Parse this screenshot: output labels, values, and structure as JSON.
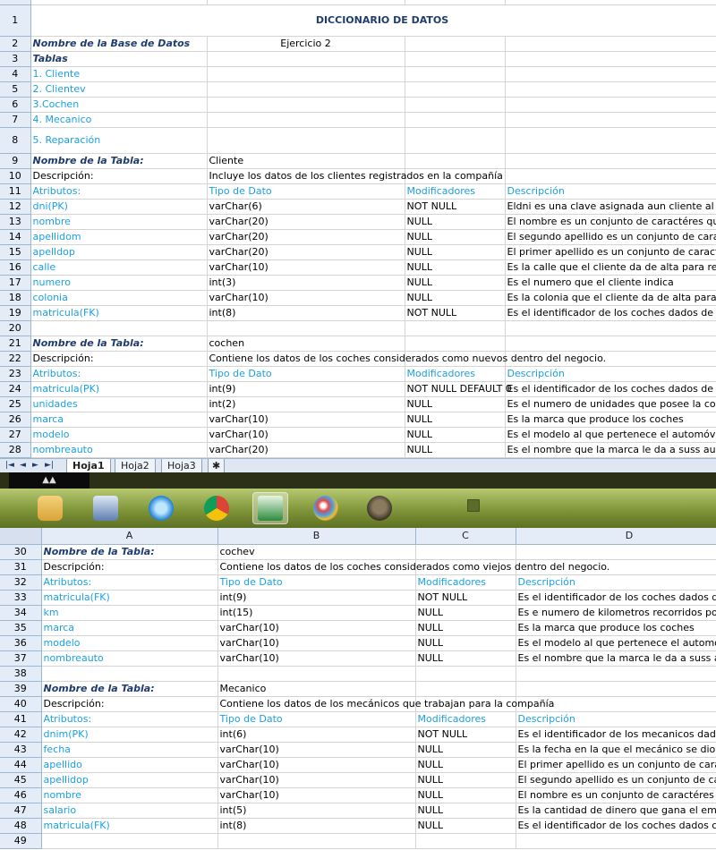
{
  "columns": [
    "A",
    "B",
    "C",
    "D"
  ],
  "sheet1": {
    "title": "DICCIONARIO DE DATOS",
    "rows": [
      {
        "n": "2",
        "a": "Nombre de la Base de Datos",
        "b": "Ejercicio 2",
        "c": "",
        "d": ""
      },
      {
        "n": "3",
        "a": "Tablas",
        "b": "",
        "c": "",
        "d": ""
      },
      {
        "n": "4",
        "a": "1. Cliente",
        "b": "",
        "c": "",
        "d": ""
      },
      {
        "n": "5",
        "a": "2. Clientev",
        "b": "",
        "c": "",
        "d": ""
      },
      {
        "n": "6",
        "a": "3.Cochen",
        "b": "",
        "c": "",
        "d": ""
      },
      {
        "n": "7",
        "a": "4. Mecanico",
        "b": "",
        "c": "",
        "d": ""
      },
      {
        "n": "8",
        "a": "5. Reparación",
        "b": "",
        "c": "",
        "d": ""
      },
      {
        "n": "9",
        "a": "Nombre de la Tabla:",
        "b": "Cliente",
        "c": "",
        "d": ""
      },
      {
        "n": "10",
        "a": "Descripción:",
        "b": "Incluye los datos de los clientes registrados en la compañía",
        "c": "",
        "d": ""
      },
      {
        "n": "11",
        "a": "Atributos:",
        "b": "Tipo de Dato",
        "c": "Modificadores",
        "d": "Descripción"
      },
      {
        "n": "12",
        "a": "dni(PK)",
        "b": "varChar(6)",
        "c": "NOT NULL",
        "d": "Eldni es una clave asignada aun cliente al"
      },
      {
        "n": "13",
        "a": "nombre",
        "b": "varChar(20)",
        "c": "NULL",
        "d": "El nombre es un conjunto de caractéres que"
      },
      {
        "n": "14",
        "a": "apellidom",
        "b": "varChar(20)",
        "c": "NULL",
        "d": "El segundo apellido es un conjunto de cara"
      },
      {
        "n": "15",
        "a": "apelldop",
        "b": "varChar(20)",
        "c": "NULL",
        "d": "El primer apellido es un conjunto de caract"
      },
      {
        "n": "16",
        "a": "calle",
        "b": "varChar(10)",
        "c": "NULL",
        "d": "Es la calle que el cliente da de alta para re"
      },
      {
        "n": "17",
        "a": "numero",
        "b": "int(3)",
        "c": "NULL",
        "d": "Es el numero que el cliente indica"
      },
      {
        "n": "18",
        "a": "colonia",
        "b": "varChar(10)",
        "c": "NULL",
        "d": "Es la colonia que el cliente da de alta para"
      },
      {
        "n": "19",
        "a": "matricula(FK)",
        "b": "int(8)",
        "c": "NOT NULL",
        "d": "Es el identificador de los coches dados de"
      },
      {
        "n": "20",
        "a": "",
        "b": "",
        "c": "",
        "d": ""
      },
      {
        "n": "21",
        "a": "Nombre de la Tabla:",
        "b": "cochen",
        "c": "",
        "d": ""
      },
      {
        "n": "22",
        "a": "Descripción:",
        "b": "Contiene los datos de los coches considerados como  nuevos dentro del negocio.",
        "c": "",
        "d": ""
      },
      {
        "n": "23",
        "a": "Atributos:",
        "b": "Tipo de Dato",
        "c": "Modificadores",
        "d": "Descripción"
      },
      {
        "n": "24",
        "a": "matricula(PK)",
        "b": "int(9)",
        "c": "NOT NULL DEFAULT 0",
        "d": "Es el identificador de los coches dados de"
      },
      {
        "n": "25",
        "a": "unidades",
        "b": "int(2)",
        "c": "NULL",
        "d": "Es el numero de unidades que posee la co"
      },
      {
        "n": "26",
        "a": "marca",
        "b": "varChar(10)",
        "c": "NULL",
        "d": "Es la marca que produce los coches"
      },
      {
        "n": "27",
        "a": "modelo",
        "b": "varChar(10)",
        "c": "NULL",
        "d": "Es el modelo al que pertenece el automóvi"
      },
      {
        "n": "28",
        "a": "nombreauto",
        "b": "varChar(20)",
        "c": "NULL",
        "d": "Es el nombre que la marca le da a suss au"
      }
    ],
    "tabs": [
      "Hoja1",
      "Hoja2",
      "Hoja3"
    ]
  },
  "sheet2": {
    "rows": [
      {
        "n": "30",
        "a": "Nombre de la Tabla:",
        "b": "cochev",
        "c": "",
        "d": ""
      },
      {
        "n": "31",
        "a": "Descripción:",
        "b": "Contiene los datos de los coches considerados como  viejos dentro del negocio.",
        "c": "",
        "d": ""
      },
      {
        "n": "32",
        "a": "Atributos:",
        "b": "Tipo de Dato",
        "c": "Modificadores",
        "d": "Descripción"
      },
      {
        "n": "33",
        "a": "matricula(FK)",
        "b": "int(9)",
        "c": "NOT NULL",
        "d": "Es el identificador de los coches dados d"
      },
      {
        "n": "34",
        "a": "km",
        "b": "int(15)",
        "c": "NULL",
        "d": "Es e numero de kilometros recorridos po"
      },
      {
        "n": "35",
        "a": "marca",
        "b": "varChar(10)",
        "c": "NULL",
        "d": "Es la marca que produce los coches"
      },
      {
        "n": "36",
        "a": "modelo",
        "b": "varChar(10)",
        "c": "NULL",
        "d": "Es el modelo al que pertenece el automo"
      },
      {
        "n": "37",
        "a": "nombreauto",
        "b": "varChar(10)",
        "c": "NULL",
        "d": "Es el nombre que la marca le da a suss a"
      },
      {
        "n": "38",
        "a": "",
        "b": "",
        "c": "",
        "d": ""
      },
      {
        "n": "39",
        "a": "Nombre de la Tabla:",
        "b": "Mecanico",
        "c": "",
        "d": ""
      },
      {
        "n": "40",
        "a": "Descripción:",
        "b": "Contiene los datos de los mecánicos que trabajan para la compañía",
        "c": "",
        "d": ""
      },
      {
        "n": "41",
        "a": "Atributos:",
        "b": "Tipo de Dato",
        "c": "Modificadores",
        "d": "Descripción"
      },
      {
        "n": "42",
        "a": "dnim(PK)",
        "b": "int(6)",
        "c": "NOT NULL",
        "d": "Es el identificador de los mecanicos dad"
      },
      {
        "n": "43",
        "a": "fecha",
        "b": "varChar(10)",
        "c": "NULL",
        "d": "Es la fecha en la que el mecánico se dio"
      },
      {
        "n": "44",
        "a": "apellido",
        "b": "varChar(10)",
        "c": "NULL",
        "d": "El primer apellido es un conjunto de cara"
      },
      {
        "n": "45",
        "a": "apellidop",
        "b": "varChar(10)",
        "c": "NULL",
        "d": "El segundo apellido es un conjunto de ca"
      },
      {
        "n": "46",
        "a": "nombre",
        "b": "varChar(10)",
        "c": "NULL",
        "d": "El nombre es un conjunto de caractéres c"
      },
      {
        "n": "47",
        "a": "salario",
        "b": "int(5)",
        "c": "NULL",
        "d": "Es la cantidad de dinero que gana el em"
      },
      {
        "n": "48",
        "a": "matricula(FK)",
        "b": "int(8)",
        "c": "NULL",
        "d": "Es el identificador de los coches dados c"
      },
      {
        "n": "49",
        "a": "",
        "b": "",
        "c": "",
        "d": ""
      }
    ]
  },
  "taskbar": {
    "icons": [
      "file-manager-icon",
      "virtualbox-icon",
      "internet-explorer-icon",
      "chrome-icon",
      "excel-icon",
      "paint-icon",
      "gimp-icon"
    ],
    "active": "excel-icon"
  }
}
